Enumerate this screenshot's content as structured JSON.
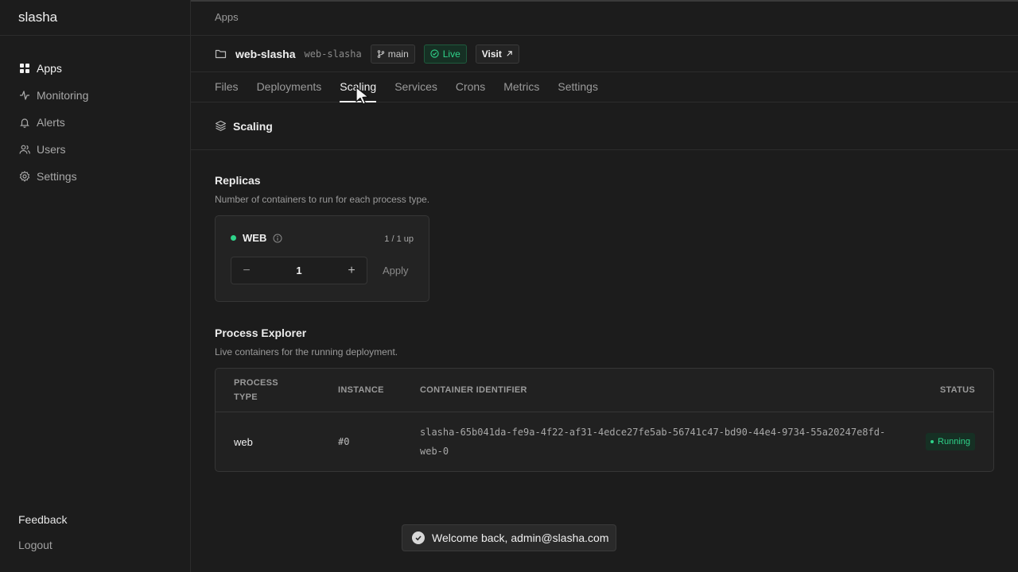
{
  "brand": "slasha",
  "sidebar": {
    "items": [
      {
        "label": "Apps",
        "icon": "grid-icon",
        "active": true
      },
      {
        "label": "Monitoring",
        "icon": "activity-icon",
        "active": false
      },
      {
        "label": "Alerts",
        "icon": "bell-icon",
        "active": false
      },
      {
        "label": "Users",
        "icon": "users-icon",
        "active": false
      },
      {
        "label": "Settings",
        "icon": "gear-icon",
        "active": false
      }
    ],
    "feedback": "Feedback",
    "logout": "Logout"
  },
  "breadcrumb": "Apps",
  "app": {
    "name": "web-slasha",
    "slug": "web-slasha",
    "branch": "main",
    "status": "Live",
    "visit": "Visit"
  },
  "tabs": [
    "Files",
    "Deployments",
    "Scaling",
    "Services",
    "Crons",
    "Metrics",
    "Settings"
  ],
  "active_tab": "Scaling",
  "section_title": "Scaling",
  "replicas": {
    "title": "Replicas",
    "subtitle": "Number of containers to run for each process type.",
    "process": "WEB",
    "up_count": "1 / 1 up",
    "value": "1",
    "minus": "−",
    "plus": "+",
    "apply": "Apply"
  },
  "process_explorer": {
    "title": "Process Explorer",
    "subtitle": "Live containers for the running deployment.",
    "columns": {
      "process_type_1": "PROCESS",
      "process_type_2": "TYPE",
      "instance": "INSTANCE",
      "container": "CONTAINER IDENTIFIER",
      "status": "STATUS"
    },
    "rows": [
      {
        "process_type": "web",
        "instance": "#0",
        "container_line1": "slasha-65b041da-fe9a-4f22-af31-4edce27fe5ab-56741c47-bd90-44e4-9734-55a20247e8fd-",
        "container_line2": "web-0",
        "status": "Running"
      }
    ]
  },
  "toast": "Welcome back, admin@slasha.com",
  "colors": {
    "accent_green": "#2fd38a",
    "background": "#1c1c1c",
    "border": "#2c2c2c"
  }
}
